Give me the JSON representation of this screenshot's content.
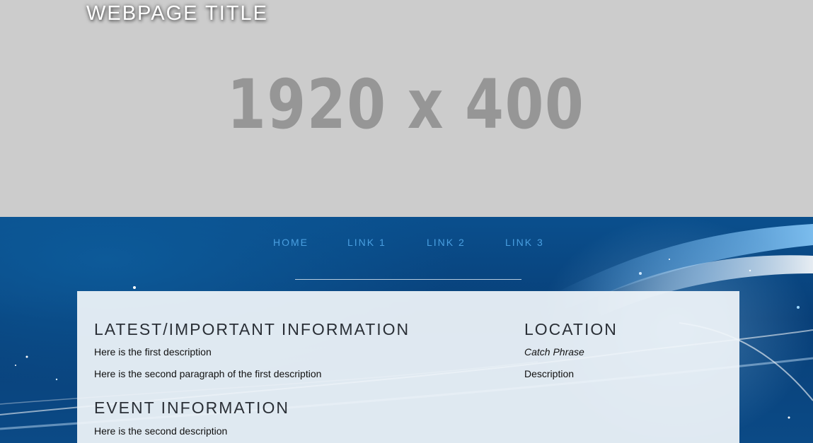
{
  "header": {
    "title": "WEBPAGE TITLE",
    "placeholder_text": "1920 x 400"
  },
  "nav": {
    "items": [
      {
        "label": "HOME"
      },
      {
        "label": "LINK 1"
      },
      {
        "label": "LINK 2"
      },
      {
        "label": "LINK 3"
      }
    ]
  },
  "main": {
    "latest": {
      "heading": "LATEST/IMPORTANT INFORMATION",
      "paragraph1": "Here is the first description",
      "paragraph2": "Here is the second paragraph of the first description"
    },
    "event": {
      "heading": "EVENT INFORMATION",
      "paragraph1": "Here is the second description"
    },
    "location": {
      "heading": "LOCATION",
      "catch_phrase": "Catch Phrase",
      "description": "Description"
    }
  },
  "colors": {
    "hero_background": "#cccccc",
    "placeholder_text": "#969696",
    "nav_link": "#4a9fe0",
    "page_background": "#0b3f72",
    "panel_background": "#f0f5fa",
    "heading_text": "#2a2f36"
  }
}
